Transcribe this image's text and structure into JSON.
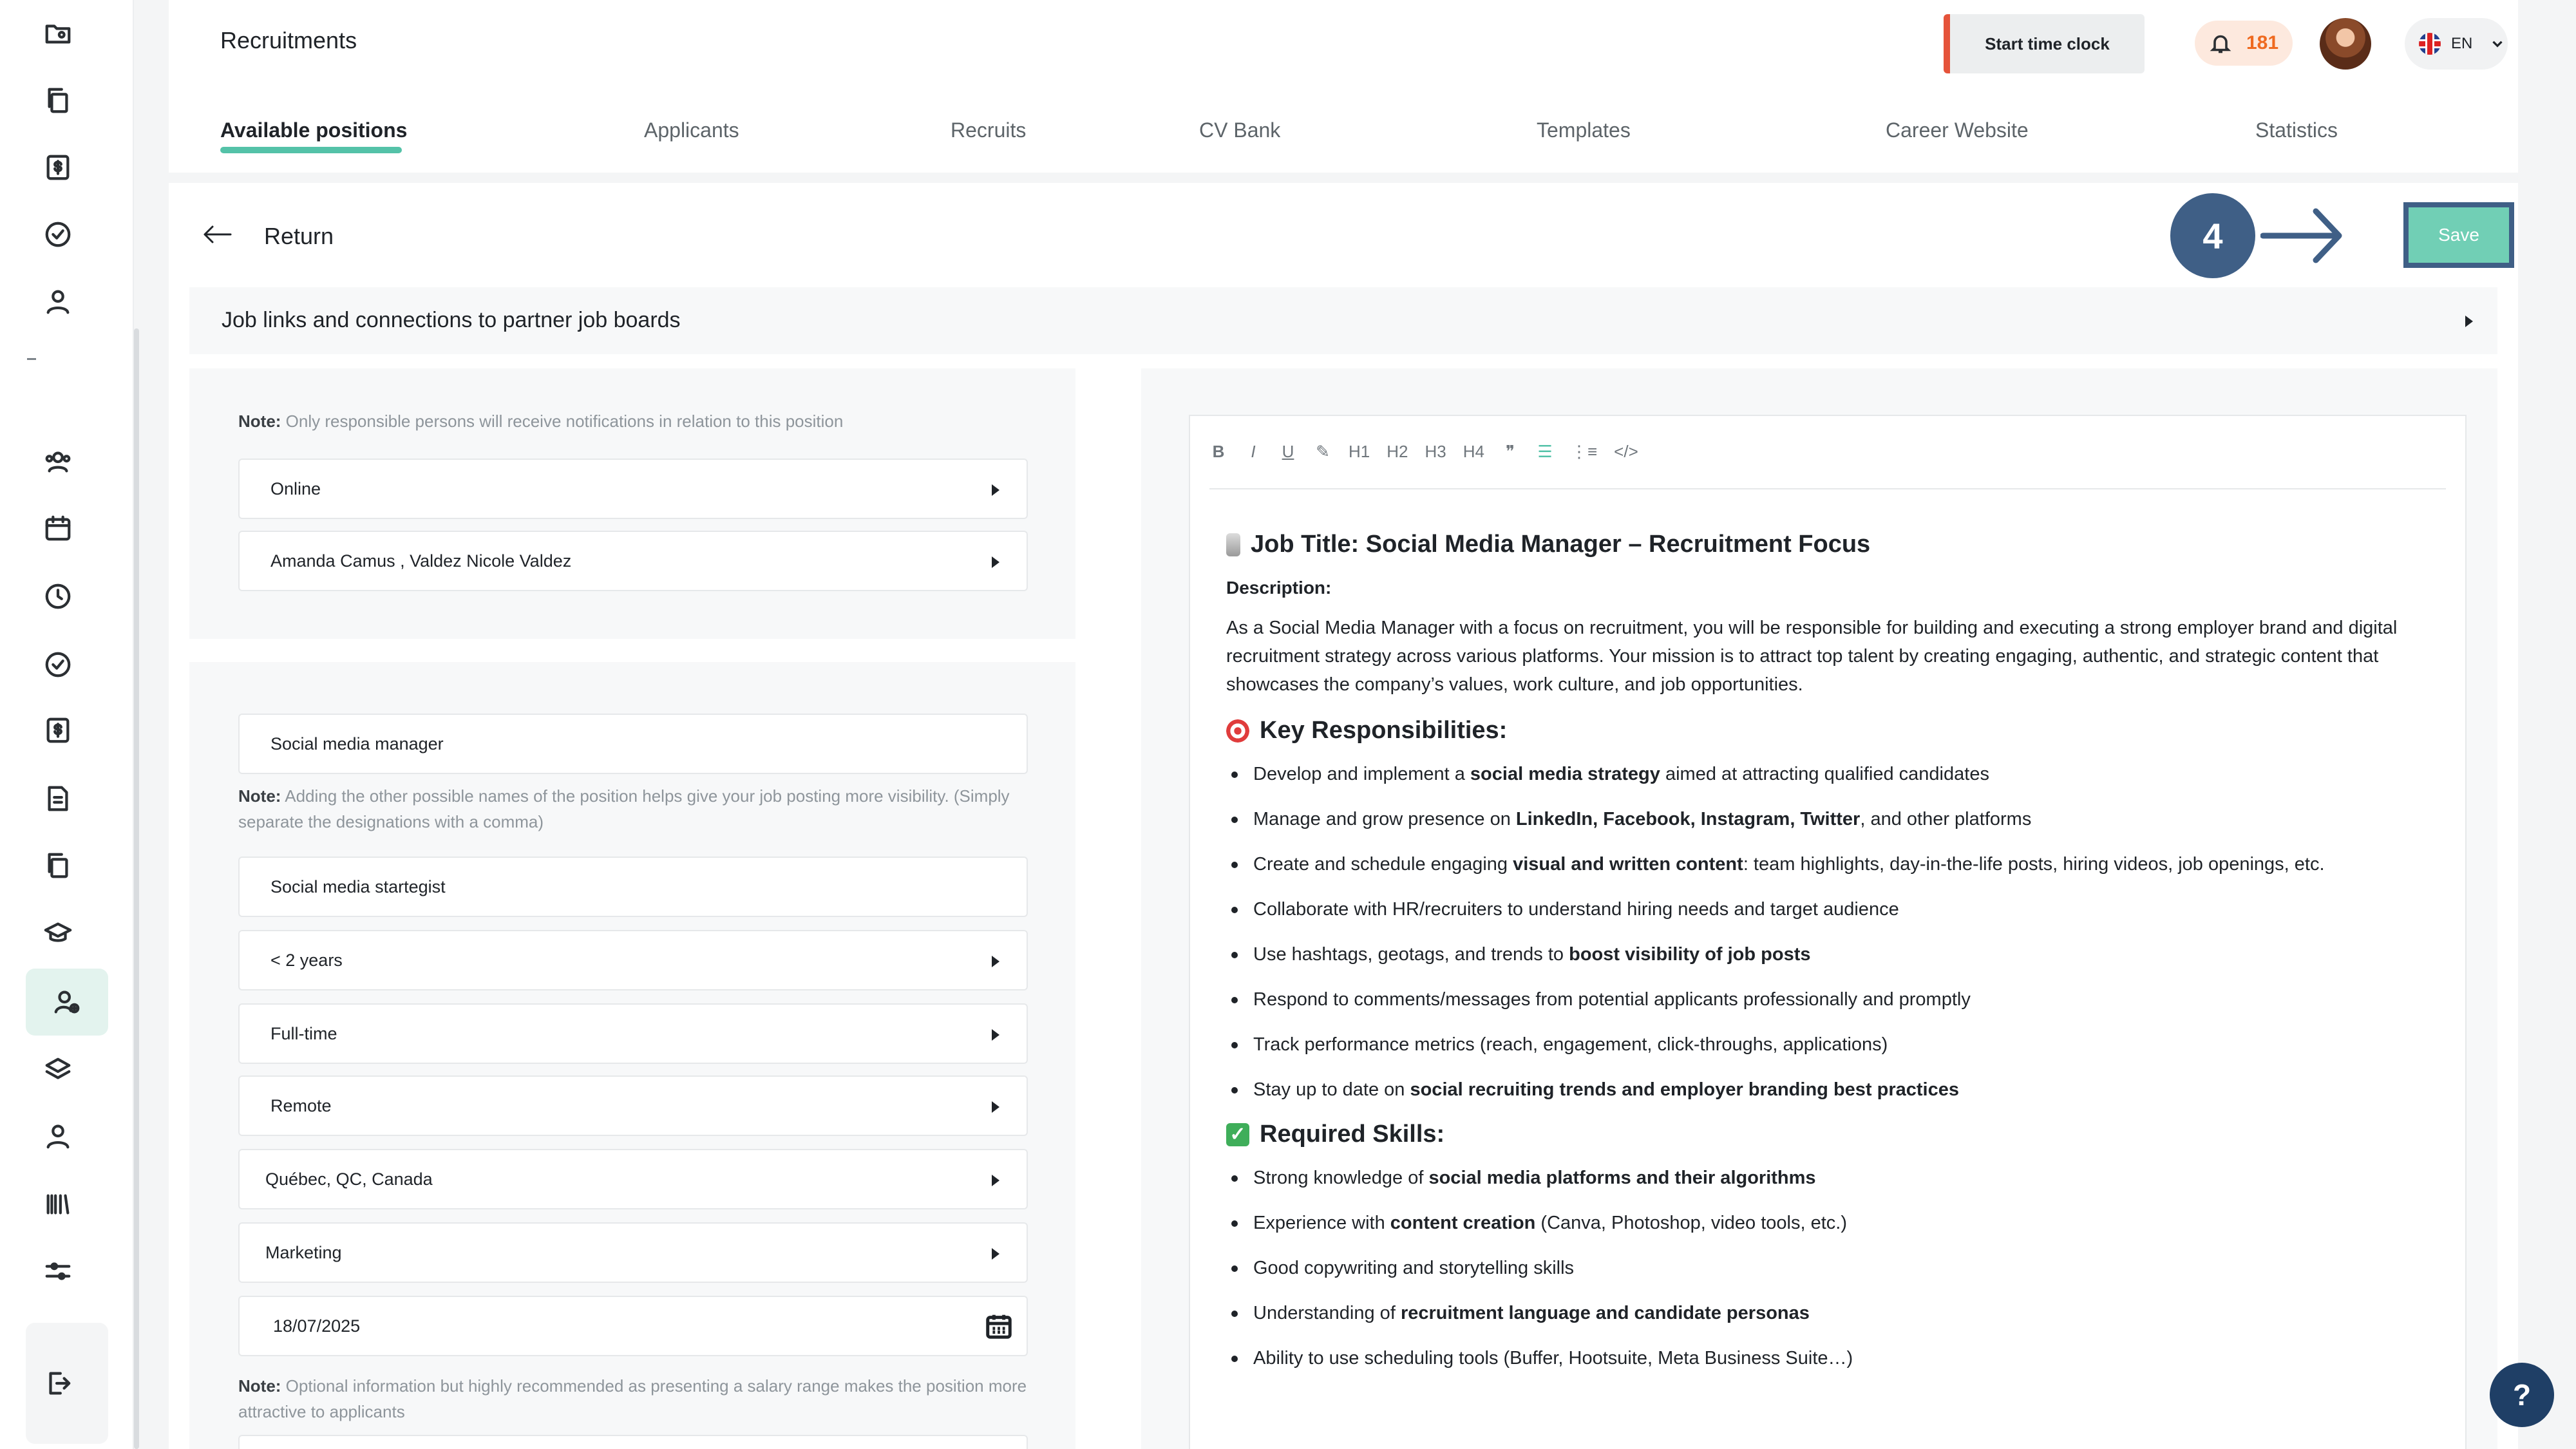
{
  "header": {
    "title": "Recruitments",
    "clock_button": "Start time clock",
    "notifications_count": "181",
    "language": "EN"
  },
  "tabs": [
    {
      "label": "Available positions",
      "active": true
    },
    {
      "label": "Applicants"
    },
    {
      "label": "Recruits"
    },
    {
      "label": "CV Bank"
    },
    {
      "label": "Templates"
    },
    {
      "label": "Career Website"
    },
    {
      "label": "Statistics"
    }
  ],
  "toolbar_top": {
    "return_label": "Return",
    "step_number": "4",
    "save_label": "Save"
  },
  "job_links": {
    "label": "Job links and connections to partner job boards"
  },
  "settings": {
    "note_label": "Note:",
    "note_text": "Only responsible persons will receive notifications in relation to this position",
    "status": "Online",
    "responsible": "Amanda  Camus , Valdez Nicole Valdez"
  },
  "position": {
    "title_value": "Social media manager",
    "note_label": "Note:",
    "alt_names_note": "Adding the other possible names of the position helps give your job posting more visibility. (Simply separate the designations with a comma)",
    "alt_names_value": "Social media startegist",
    "experience": "< 2 years",
    "employment_type": "Full-time",
    "work_mode": "Remote",
    "location": "Québec, QC, Canada",
    "department": "Marketing",
    "date": "18/07/2025",
    "salary_note": "Optional information but highly recommended as presenting a salary range makes the position more attractive to applicants"
  },
  "editor": {
    "toolbar": [
      "B",
      "I",
      "U",
      "✎",
      "H1",
      "H2",
      "H3",
      "H4",
      "❞",
      "☰",
      "⋮≡",
      "</>"
    ],
    "job_title": "Job Title: Social Media Manager – Recruitment Focus",
    "description_label": "Description:",
    "description": "As a Social Media Manager with a focus on recruitment, you will be responsible for building and executing a strong employer brand and digital recruitment strategy across various platforms. Your mission is to attract top talent by creating engaging, authentic, and strategic content that showcases the company’s values, work culture, and job opportunities.",
    "responsibilities_heading": "Key Responsibilities:",
    "responsibilities": [
      {
        "pre": "Develop and implement a ",
        "bold": "social media strategy",
        "post": " aimed at attracting qualified candidates"
      },
      {
        "pre": "Manage and grow presence on ",
        "bold": "LinkedIn, Facebook, Instagram, Twitter",
        "post": ", and other platforms"
      },
      {
        "pre": "Create and schedule engaging ",
        "bold": "visual and written content",
        "post": ": team highlights, day-in-the-life posts, hiring videos, job openings, etc."
      },
      {
        "pre": "Collaborate with HR/recruiters to understand hiring needs and target audience",
        "bold": "",
        "post": ""
      },
      {
        "pre": "Use hashtags, geotags, and trends to ",
        "bold": "boost visibility of job posts",
        "post": ""
      },
      {
        "pre": "Respond to comments/messages from potential applicants professionally and promptly",
        "bold": "",
        "post": ""
      },
      {
        "pre": "Track performance metrics (reach, engagement, click-throughs, applications)",
        "bold": "",
        "post": ""
      },
      {
        "pre": "Stay up to date on ",
        "bold": "social recruiting trends and employer branding best practices",
        "post": ""
      }
    ],
    "skills_heading": "Required Skills:",
    "skills": [
      {
        "pre": "Strong knowledge of ",
        "bold": "social media platforms and their algorithms",
        "post": ""
      },
      {
        "pre": "Experience with ",
        "bold": "content creation",
        "post": " (Canva, Photoshop, video tools, etc.)"
      },
      {
        "pre": "Good copywriting and storytelling skills",
        "bold": "",
        "post": ""
      },
      {
        "pre": "Understanding of ",
        "bold": "recruitment language and candidate personas",
        "post": ""
      },
      {
        "pre": "Ability to use scheduling tools (Buffer, Hootsuite, Meta Business Suite…)",
        "bold": "",
        "post": ""
      }
    ]
  },
  "help_label": "?",
  "colors": {
    "accent": "#54c2a8",
    "step": "#3f5f86",
    "alert": "#e5533a",
    "notif": "#ef6a20"
  }
}
